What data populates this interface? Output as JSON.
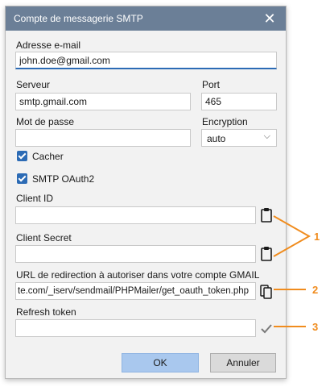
{
  "window": {
    "title": "Compte de messagerie SMTP"
  },
  "email": {
    "label": "Adresse e-mail",
    "value": "john.doe@gmail.com"
  },
  "server": {
    "label": "Serveur",
    "value": "smtp.gmail.com"
  },
  "port": {
    "label": "Port",
    "value": "465"
  },
  "password": {
    "label": "Mot de passe",
    "value": ""
  },
  "encryption": {
    "label": "Encryption",
    "value": "auto"
  },
  "hide": {
    "label": "Cacher",
    "checked": true
  },
  "oauth": {
    "label": "SMTP OAuth2",
    "checked": true
  },
  "client_id": {
    "label": "Client ID",
    "value": ""
  },
  "client_secret": {
    "label": "Client Secret",
    "value": ""
  },
  "redirect": {
    "label": "URL de redirection à autoriser dans votre compte GMAIL",
    "value": "te.com/_iserv/sendmail/PHPMailer/get_oauth_token.php"
  },
  "refresh": {
    "label": "Refresh token",
    "value": ""
  },
  "buttons": {
    "ok": "OK",
    "cancel": "Annuler"
  },
  "callouts": {
    "one": "1",
    "two": "2",
    "three": "3"
  },
  "colors": {
    "accent": "#2c6bb5",
    "titlebar": "#6b7f97",
    "callout": "#f08c1e"
  }
}
